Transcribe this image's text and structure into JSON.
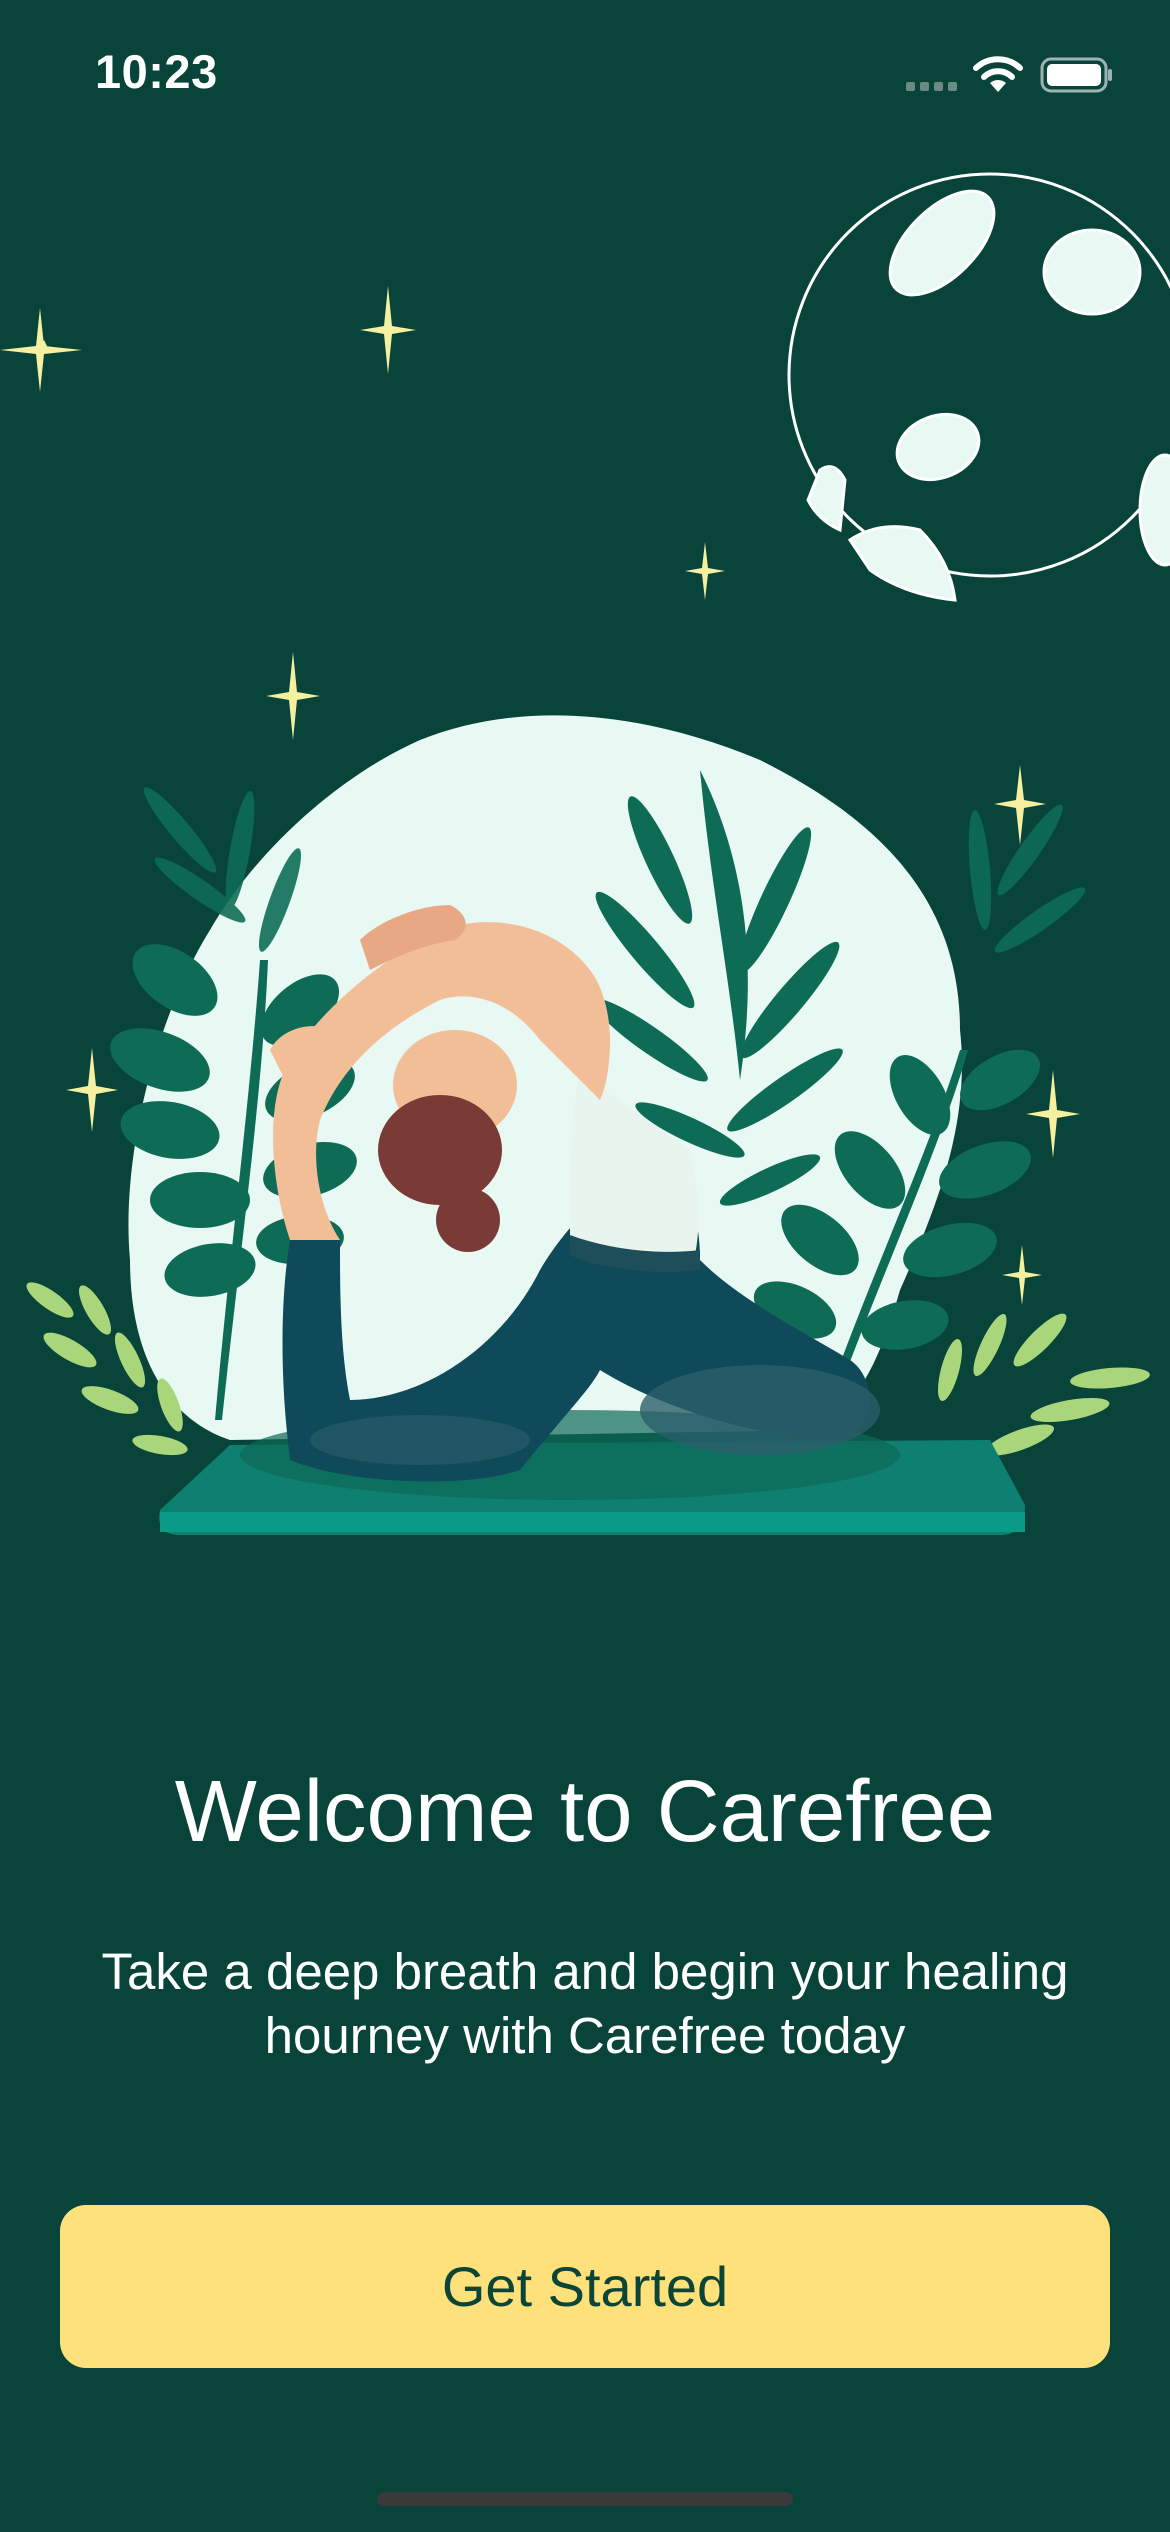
{
  "status_bar": {
    "time": "10:23",
    "icons": [
      "cellular-signal-icon",
      "wifi-icon",
      "battery-icon"
    ]
  },
  "illustration": {
    "subject": "woman doing yoga king pigeon pose on mat with plants, stars and moon"
  },
  "welcome": {
    "title": "Welcome to Carefree",
    "subtitle": "Take a deep breath and begin your healing\nhourney with Carefree today"
  },
  "cta": {
    "label": "Get Started"
  },
  "colors": {
    "background": "#08443A",
    "button": "#FEE17A",
    "button_text": "#0B4538",
    "star": "#F5EFA0",
    "blob": "#E8F8F2"
  }
}
